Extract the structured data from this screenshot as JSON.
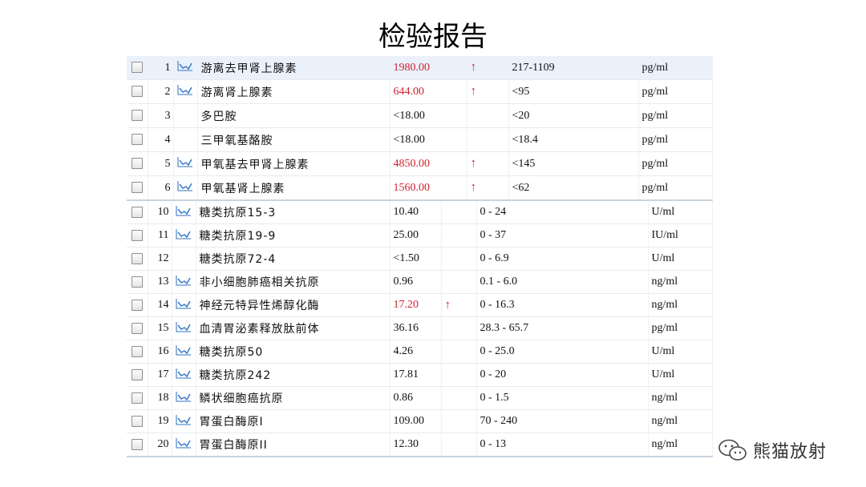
{
  "title": "检验报告",
  "colors": {
    "high_value": "#d0202e",
    "highlight_row": "#eaf1fb"
  },
  "table_a": {
    "rows": [
      {
        "num": "1",
        "trend": true,
        "name": "游离去甲肾上腺素",
        "value": "1980.00",
        "high": true,
        "flag": "↑",
        "range": "217-1109",
        "unit": "pg/ml"
      },
      {
        "num": "2",
        "trend": true,
        "name": "游离肾上腺素",
        "value": "644.00",
        "high": true,
        "flag": "↑",
        "range": "<95",
        "unit": "pg/ml"
      },
      {
        "num": "3",
        "trend": false,
        "name": "多巴胺",
        "value": "<18.00",
        "high": false,
        "flag": "",
        "range": "<20",
        "unit": "pg/ml"
      },
      {
        "num": "4",
        "trend": false,
        "name": "三甲氧基酪胺",
        "value": "<18.00",
        "high": false,
        "flag": "",
        "range": "<18.4",
        "unit": "pg/ml"
      },
      {
        "num": "5",
        "trend": true,
        "name": "甲氧基去甲肾上腺素",
        "value": "4850.00",
        "high": true,
        "flag": "↑",
        "range": "<145",
        "unit": "pg/ml"
      },
      {
        "num": "6",
        "trend": true,
        "name": "甲氧基肾上腺素",
        "value": "1560.00",
        "high": true,
        "flag": "↑",
        "range": "<62",
        "unit": "pg/ml"
      }
    ]
  },
  "table_b": {
    "rows": [
      {
        "num": "10",
        "trend": true,
        "name": "糖类抗原15-3",
        "value": "10.40",
        "high": false,
        "flag": "",
        "range": "0 - 24",
        "unit": "U/ml"
      },
      {
        "num": "11",
        "trend": true,
        "name": "糖类抗原19-9",
        "value": "25.00",
        "high": false,
        "flag": "",
        "range": "0 - 37",
        "unit": "IU/ml"
      },
      {
        "num": "12",
        "trend": false,
        "name": "糖类抗原72-4",
        "value": "<1.50",
        "high": false,
        "flag": "",
        "range": "0 - 6.9",
        "unit": "U/ml"
      },
      {
        "num": "13",
        "trend": true,
        "name": "非小细胞肺癌相关抗原",
        "value": "0.96",
        "high": false,
        "flag": "",
        "range": "0.1 - 6.0",
        "unit": "ng/ml"
      },
      {
        "num": "14",
        "trend": true,
        "name": "神经元特异性烯醇化酶",
        "value": "17.20",
        "high": true,
        "flag": "↑",
        "range": "0 - 16.3",
        "unit": "ng/ml"
      },
      {
        "num": "15",
        "trend": true,
        "name": "血清胃泌素释放肽前体",
        "value": "36.16",
        "high": false,
        "flag": "",
        "range": "28.3 - 65.7",
        "unit": "pg/ml"
      },
      {
        "num": "16",
        "trend": true,
        "name": "糖类抗原50",
        "value": "4.26",
        "high": false,
        "flag": "",
        "range": "0 - 25.0",
        "unit": "U/ml"
      },
      {
        "num": "17",
        "trend": true,
        "name": "糖类抗原242",
        "value": "17.81",
        "high": false,
        "flag": "",
        "range": "0 - 20",
        "unit": "U/ml"
      },
      {
        "num": "18",
        "trend": true,
        "name": "鳞状细胞癌抗原",
        "value": "0.86",
        "high": false,
        "flag": "",
        "range": "0 - 1.5",
        "unit": "ng/ml"
      },
      {
        "num": "19",
        "trend": true,
        "name": "胃蛋白酶原I",
        "value": "109.00",
        "high": false,
        "flag": "",
        "range": "70 - 240",
        "unit": "ng/ml"
      },
      {
        "num": "20",
        "trend": true,
        "name": "胃蛋白酶原II",
        "value": "12.30",
        "high": false,
        "flag": "",
        "range": "0 - 13",
        "unit": "ng/ml"
      }
    ]
  },
  "watermark": {
    "text": "熊猫放射",
    "icon": "wechat-icon"
  }
}
